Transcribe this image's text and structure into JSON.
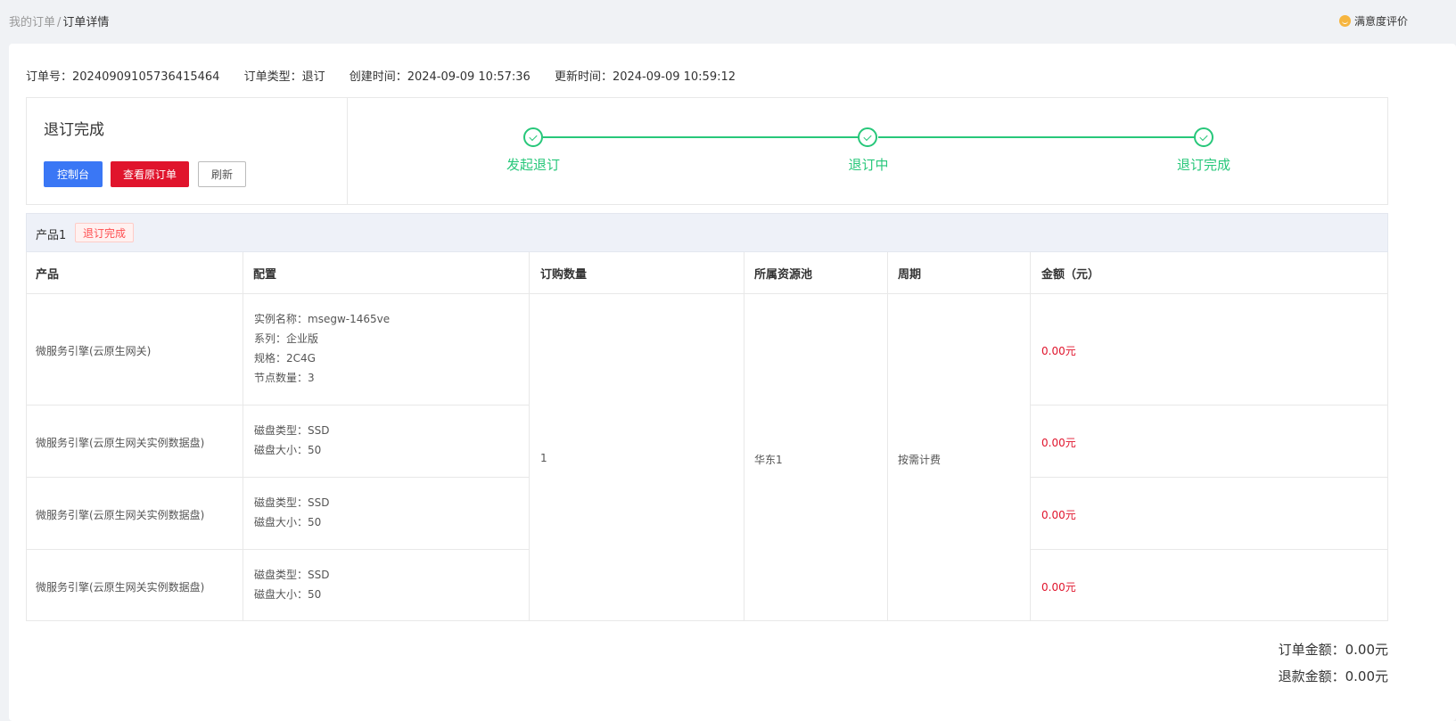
{
  "breadcrumb": {
    "parent": "我的订单",
    "separator": "/",
    "current": "订单详情"
  },
  "feedback": {
    "label": "满意度评价"
  },
  "order": {
    "number": "订单号：20240909105736415464",
    "type": "订单类型：退订",
    "created": "创建时间：2024-09-09 10:57:36",
    "updated": "更新时间：2024-09-09 10:59:12"
  },
  "status": {
    "title": "退订完成",
    "buttons": {
      "console": "控制台",
      "view_original": "查看原订单",
      "refresh": "刷新"
    },
    "steps": [
      {
        "label": "发起退订",
        "done": true
      },
      {
        "label": "退订中",
        "done": true
      },
      {
        "label": "退订完成",
        "done": true
      }
    ],
    "step_color": "#27c77a"
  },
  "product": {
    "name": "产品1",
    "tag": "退订完成",
    "columns": [
      "产品",
      "配置",
      "订购数量",
      "所属资源池",
      "周期",
      "金额（元）"
    ],
    "quantity": "1",
    "pool": "华东1",
    "period": "按需计费",
    "rows": [
      {
        "product": "微服务引擎(云原生网关)",
        "config": [
          "实例名称：msegw-1465ve",
          "系列：企业版",
          "规格：2C4G",
          "节点数量：3"
        ],
        "amount": "0.00元"
      },
      {
        "product": "微服务引擎(云原生网关实例数据盘)",
        "config": [
          "磁盘类型：SSD",
          "磁盘大小：50"
        ],
        "amount": "0.00元"
      },
      {
        "product": "微服务引擎(云原生网关实例数据盘)",
        "config": [
          "磁盘类型：SSD",
          "磁盘大小：50"
        ],
        "amount": "0.00元"
      },
      {
        "product": "微服务引擎(云原生网关实例数据盘)",
        "config": [
          "磁盘类型：SSD",
          "磁盘大小：50"
        ],
        "amount": "0.00元"
      }
    ]
  },
  "totals": {
    "order_amount": "订单金额：0.00元",
    "refund_amount": "退款金额：0.00元"
  },
  "colors": {
    "primary": "#3a77f5",
    "danger": "#e0142c",
    "success": "#27c77a"
  }
}
